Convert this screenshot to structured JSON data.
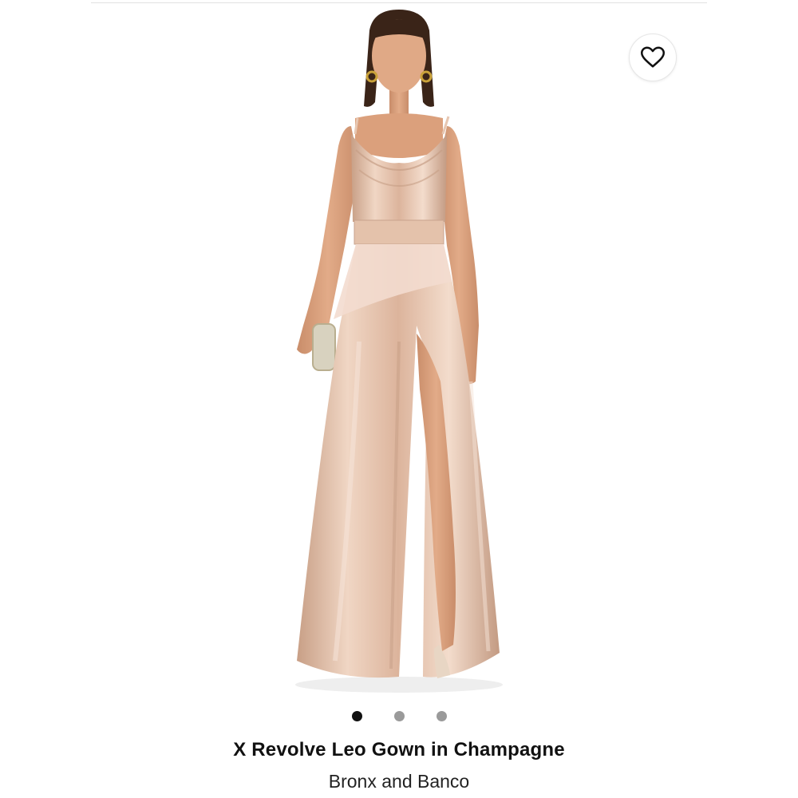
{
  "product": {
    "title": "X Revolve Leo Gown in Champagne",
    "brand": "Bronx and Banco",
    "image_description_icon": "model-wearing-champagne-satin-gown",
    "color_accent": "#e6c8b2"
  },
  "wishlist": {
    "icon": "heart-outline-icon"
  },
  "carousel": {
    "total_images": 3,
    "active_index": 0
  },
  "colors": {
    "dot_active": "#111111",
    "dot_inactive": "#9a9a9a",
    "gown": "#e8c9b4",
    "gown_shadow": "#c9a38c",
    "skin": "#d9a07c",
    "hair": "#3a2418"
  }
}
